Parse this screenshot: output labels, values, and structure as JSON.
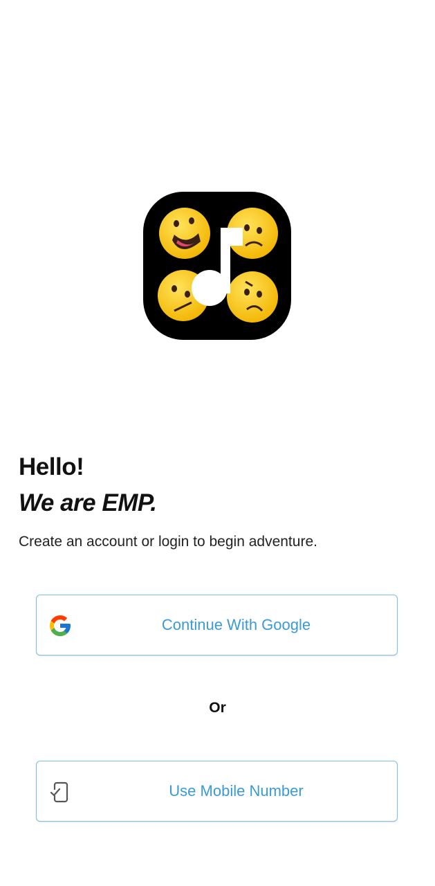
{
  "logo": {
    "icon": "emp-app-logo",
    "background": "#000000",
    "emoji_color": "#f9c70c"
  },
  "greeting": "Hello!",
  "tagline": "We are EMP.",
  "subtitle": "Create an account or login to begin adventure.",
  "google_button": {
    "label": "Continue With Google",
    "icon": "google-icon"
  },
  "divider_text": "Or",
  "mobile_button": {
    "label": "Use Mobile Number",
    "icon": "mobile-check-icon"
  },
  "colors": {
    "button_border": "#7fc0dc",
    "button_text": "#3a9ad2"
  }
}
